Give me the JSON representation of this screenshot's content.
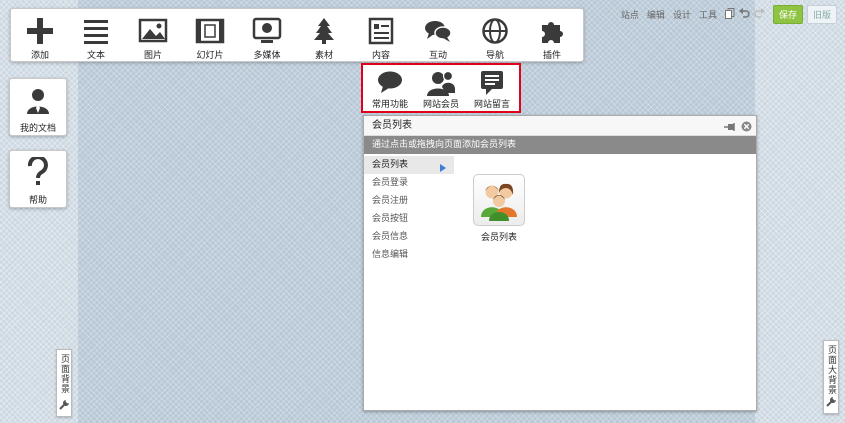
{
  "toolbar": {
    "items": [
      {
        "label": "添加",
        "icon": "plus-icon"
      },
      {
        "label": "文本",
        "icon": "text-lines-icon"
      },
      {
        "label": "图片",
        "icon": "image-icon"
      },
      {
        "label": "幻灯片",
        "icon": "film-strip-icon"
      },
      {
        "label": "多媒体",
        "icon": "multimedia-icon"
      },
      {
        "label": "素材",
        "icon": "tree-icon"
      },
      {
        "label": "内容",
        "icon": "document-icon"
      },
      {
        "label": "互动",
        "icon": "chat-bubbles-icon"
      },
      {
        "label": "导航",
        "icon": "globe-icon"
      },
      {
        "label": "插件",
        "icon": "puzzle-icon"
      }
    ]
  },
  "topright": {
    "site": "站点",
    "edit": "编辑",
    "design": "设计",
    "tools": "工具",
    "save": "保存",
    "old_version": "旧版"
  },
  "sidebar": {
    "my_docs": "我的文档",
    "help": "帮助",
    "page_background": "页面背景",
    "page_big_background": "页面大背景"
  },
  "subtoolbar": {
    "items": [
      {
        "label": "常用功能",
        "icon": "speech-bubble-icon"
      },
      {
        "label": "网站会员",
        "icon": "members-icon"
      },
      {
        "label": "网站留言",
        "icon": "message-board-icon"
      }
    ]
  },
  "panel": {
    "title": "会员列表",
    "hint": "通过点击或拖拽向页面添加会员列表",
    "menu": [
      "会员列表",
      "会员登录",
      "会员注册",
      "会员按钮",
      "会员信息",
      "信息编辑"
    ],
    "widget_label": "会员列表"
  },
  "colors": {
    "save_green": "#8fc442",
    "highlight_red": "#e0001b",
    "hint_bar": "#8a8a8a"
  }
}
